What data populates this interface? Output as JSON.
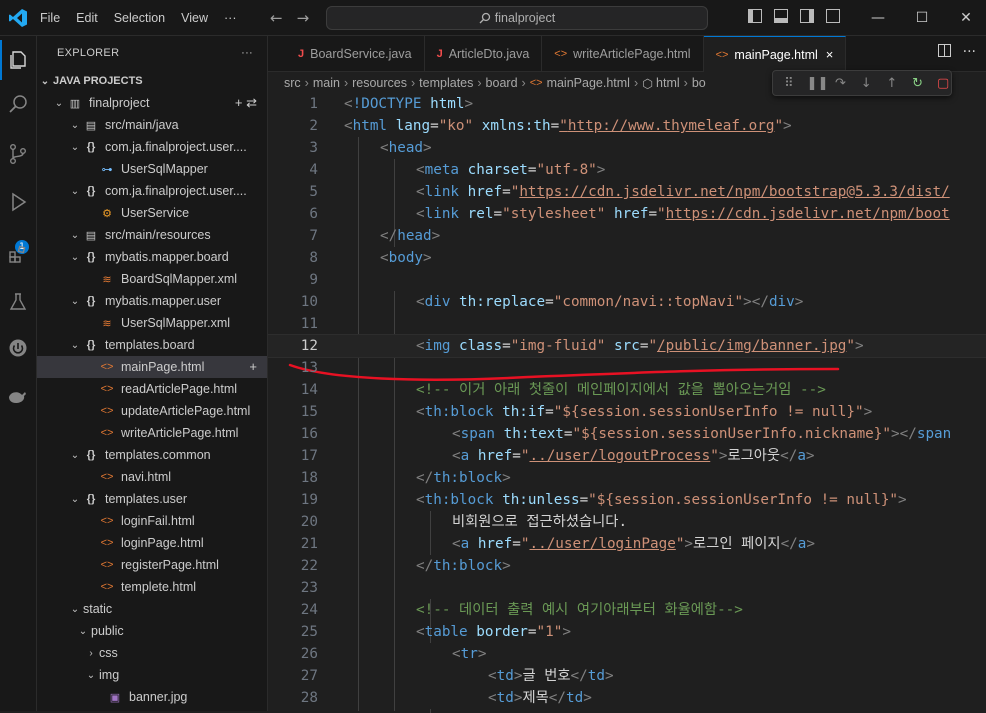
{
  "menu": {
    "items": [
      "File",
      "Edit",
      "Selection",
      "View",
      "···"
    ]
  },
  "search": {
    "text": "finalproject"
  },
  "explorer": {
    "header": "EXPLORER",
    "more": "···",
    "section": "JAVA PROJECTS",
    "tree": [
      {
        "label": "finalproject",
        "chev": "⌄",
        "icon": "▥",
        "iconClass": "folder",
        "depth": 0
      },
      {
        "label": "src/main/java",
        "chev": "⌄",
        "icon": "▤",
        "iconClass": "folder",
        "depth": 1
      },
      {
        "label": "com.ja.finalproject.user....",
        "chev": "⌄",
        "icon": "{}",
        "iconClass": "pkg",
        "depth": 1
      },
      {
        "label": "UserSqlMapper",
        "chev": "",
        "icon": "⊶",
        "iconClass": "iface",
        "depth": 2
      },
      {
        "label": "com.ja.finalproject.user....",
        "chev": "⌄",
        "icon": "{}",
        "iconClass": "pkg",
        "depth": 1
      },
      {
        "label": "UserService",
        "chev": "",
        "icon": "⚙",
        "iconClass": "cls",
        "depth": 2
      },
      {
        "label": "src/main/resources",
        "chev": "⌄",
        "icon": "▤",
        "iconClass": "folder",
        "depth": 1
      },
      {
        "label": "mybatis.mapper.board",
        "chev": "⌄",
        "icon": "{}",
        "iconClass": "pkg",
        "depth": 1
      },
      {
        "label": "BoardSqlMapper.xml",
        "chev": "",
        "icon": "≋",
        "iconClass": "xml",
        "depth": 2
      },
      {
        "label": "mybatis.mapper.user",
        "chev": "⌄",
        "icon": "{}",
        "iconClass": "pkg",
        "depth": 1
      },
      {
        "label": "UserSqlMapper.xml",
        "chev": "",
        "icon": "≋",
        "iconClass": "xml",
        "depth": 2
      },
      {
        "label": "templates.board",
        "chev": "⌄",
        "icon": "{}",
        "iconClass": "pkg",
        "depth": 1
      },
      {
        "label": "mainPage.html",
        "chev": "",
        "icon": "<>",
        "iconClass": "html",
        "depth": 2,
        "selected": true
      },
      {
        "label": "readArticlePage.html",
        "chev": "",
        "icon": "<>",
        "iconClass": "html",
        "depth": 2
      },
      {
        "label": "updateArticlePage.html",
        "chev": "",
        "icon": "<>",
        "iconClass": "html",
        "depth": 2
      },
      {
        "label": "writeArticlePage.html",
        "chev": "",
        "icon": "<>",
        "iconClass": "html",
        "depth": 2
      },
      {
        "label": "templates.common",
        "chev": "⌄",
        "icon": "{}",
        "iconClass": "pkg",
        "depth": 1
      },
      {
        "label": "navi.html",
        "chev": "",
        "icon": "<>",
        "iconClass": "html",
        "depth": 2
      },
      {
        "label": "templates.user",
        "chev": "⌄",
        "icon": "{}",
        "iconClass": "pkg",
        "depth": 1
      },
      {
        "label": "loginFail.html",
        "chev": "",
        "icon": "<>",
        "iconClass": "html",
        "depth": 2
      },
      {
        "label": "loginPage.html",
        "chev": "",
        "icon": "<>",
        "iconClass": "html",
        "depth": 2
      },
      {
        "label": "registerPage.html",
        "chev": "",
        "icon": "<>",
        "iconClass": "html",
        "depth": 2
      },
      {
        "label": "templete.html",
        "chev": "",
        "icon": "<>",
        "iconClass": "html",
        "depth": 2
      },
      {
        "label": "static",
        "chev": "⌄",
        "icon": "",
        "iconClass": "folder",
        "depth": 1
      },
      {
        "label": "public",
        "chev": "⌄",
        "icon": "",
        "iconClass": "folder",
        "depth": 1.5
      },
      {
        "label": "css",
        "chev": "›",
        "icon": "",
        "iconClass": "folder",
        "depth": 2
      },
      {
        "label": "img",
        "chev": "⌄",
        "icon": "",
        "iconClass": "folder",
        "depth": 2
      },
      {
        "label": "banner.jpg",
        "chev": "",
        "icon": "▣",
        "iconClass": "img",
        "depth": 2.5
      }
    ]
  },
  "tabs": [
    {
      "label": "BoardService.java",
      "icon": "J",
      "iconColor": "#f14c4c"
    },
    {
      "label": "ArticleDto.java",
      "icon": "J",
      "iconColor": "#f14c4c"
    },
    {
      "label": "writeArticlePage.html",
      "icon": "<>",
      "iconColor": "#e37933"
    },
    {
      "label": "mainPage.html",
      "icon": "<>",
      "iconColor": "#e37933",
      "active": true,
      "close": "×"
    }
  ],
  "breadcrumb": [
    "src",
    "main",
    "resources",
    "templates",
    "board",
    "mainPage.html",
    "html",
    "bo"
  ],
  "badge": "1",
  "code": {
    "currentLine": 12,
    "lines": [
      {
        "n": 1,
        "ind": 0,
        "toks": [
          [
            "punc",
            "<"
          ],
          [
            "tag",
            "!DOCTYPE"
          ],
          [
            "txt",
            " "
          ],
          [
            "attr",
            "html"
          ],
          [
            "punc",
            ">"
          ]
        ]
      },
      {
        "n": 2,
        "ind": 0,
        "toks": [
          [
            "punc",
            "<"
          ],
          [
            "tag",
            "html"
          ],
          [
            "txt",
            " "
          ],
          [
            "attr",
            "lang"
          ],
          [
            "txt",
            "="
          ],
          [
            "str",
            "\"ko\""
          ],
          [
            "txt",
            " "
          ],
          [
            "attr",
            "xmlns:th"
          ],
          [
            "txt",
            "="
          ],
          [
            "str",
            "\"",
            "u"
          ],
          [
            "str",
            "http://www.thymeleaf.org",
            "u"
          ],
          [
            "str",
            "\""
          ],
          [
            "punc",
            ">"
          ]
        ]
      },
      {
        "n": 3,
        "ind": 1,
        "toks": [
          [
            "punc",
            "<"
          ],
          [
            "tag",
            "head"
          ],
          [
            "punc",
            ">"
          ]
        ]
      },
      {
        "n": 4,
        "ind": 2,
        "toks": [
          [
            "punc",
            "<"
          ],
          [
            "tag",
            "meta"
          ],
          [
            "txt",
            " "
          ],
          [
            "attr",
            "charset"
          ],
          [
            "txt",
            "="
          ],
          [
            "str",
            "\"utf-8\""
          ],
          [
            "punc",
            ">"
          ]
        ]
      },
      {
        "n": 5,
        "ind": 2,
        "toks": [
          [
            "punc",
            "<"
          ],
          [
            "tag",
            "link"
          ],
          [
            "txt",
            " "
          ],
          [
            "attr",
            "href"
          ],
          [
            "txt",
            "="
          ],
          [
            "str",
            "\""
          ],
          [
            "str",
            "https://cdn.jsdelivr.net/npm/bootstrap@5.3.3/dist/",
            "u"
          ]
        ]
      },
      {
        "n": 6,
        "ind": 2,
        "toks": [
          [
            "punc",
            "<"
          ],
          [
            "tag",
            "link"
          ],
          [
            "txt",
            " "
          ],
          [
            "attr",
            "rel"
          ],
          [
            "txt",
            "="
          ],
          [
            "str",
            "\"stylesheet\""
          ],
          [
            "txt",
            " "
          ],
          [
            "attr",
            "href"
          ],
          [
            "txt",
            "="
          ],
          [
            "str",
            "\""
          ],
          [
            "str",
            "https://cdn.jsdelivr.net/npm/boot",
            "u"
          ]
        ]
      },
      {
        "n": 7,
        "ind": 1,
        "toks": [
          [
            "punc",
            "</"
          ],
          [
            "tag",
            "head"
          ],
          [
            "punc",
            ">"
          ]
        ]
      },
      {
        "n": 8,
        "ind": 1,
        "toks": [
          [
            "punc",
            "<"
          ],
          [
            "tag",
            "body"
          ],
          [
            "punc",
            ">"
          ]
        ]
      },
      {
        "n": 9,
        "ind": 0,
        "toks": []
      },
      {
        "n": 10,
        "ind": 2,
        "toks": [
          [
            "punc",
            "<"
          ],
          [
            "tag",
            "div"
          ],
          [
            "txt",
            " "
          ],
          [
            "attr",
            "th:replace"
          ],
          [
            "txt",
            "="
          ],
          [
            "str",
            "\"common/navi::topNavi\""
          ],
          [
            "punc",
            ">"
          ],
          [
            "punc",
            "</"
          ],
          [
            "tag",
            "div"
          ],
          [
            "punc",
            ">"
          ]
        ]
      },
      {
        "n": 11,
        "ind": 0,
        "toks": []
      },
      {
        "n": 12,
        "ind": 2,
        "toks": [
          [
            "punc",
            "<"
          ],
          [
            "tag",
            "img"
          ],
          [
            "txt",
            " "
          ],
          [
            "attr",
            "class"
          ],
          [
            "txt",
            "="
          ],
          [
            "str",
            "\"img-fluid\""
          ],
          [
            "txt",
            " "
          ],
          [
            "attr",
            "src"
          ],
          [
            "txt",
            "="
          ],
          [
            "str",
            "\""
          ],
          [
            "str",
            "/public/img/banner.jpg",
            "u"
          ],
          [
            "str",
            "\""
          ],
          [
            "punc",
            ">"
          ]
        ]
      },
      {
        "n": 13,
        "ind": 0,
        "toks": []
      },
      {
        "n": 14,
        "ind": 2,
        "toks": [
          [
            "com",
            "<!-- 이거 아래 첫줄이 메인페이지에서 값을 뽑아오는거임 -->"
          ]
        ]
      },
      {
        "n": 15,
        "ind": 2,
        "toks": [
          [
            "punc",
            "<"
          ],
          [
            "tag",
            "th:block"
          ],
          [
            "txt",
            " "
          ],
          [
            "attr",
            "th:if"
          ],
          [
            "txt",
            "="
          ],
          [
            "str",
            "\"${session.sessionUserInfo != null}\""
          ],
          [
            "punc",
            ">"
          ]
        ]
      },
      {
        "n": 16,
        "ind": 3,
        "toks": [
          [
            "punc",
            "<"
          ],
          [
            "tag",
            "span"
          ],
          [
            "txt",
            " "
          ],
          [
            "attr",
            "th:text"
          ],
          [
            "txt",
            "="
          ],
          [
            "str",
            "\"${session.sessionUserInfo.nickname}\""
          ],
          [
            "punc",
            ">"
          ],
          [
            "punc",
            "</"
          ],
          [
            "tag",
            "span"
          ]
        ]
      },
      {
        "n": 17,
        "ind": 3,
        "toks": [
          [
            "punc",
            "<"
          ],
          [
            "tag",
            "a"
          ],
          [
            "txt",
            " "
          ],
          [
            "attr",
            "href"
          ],
          [
            "txt",
            "="
          ],
          [
            "str",
            "\""
          ],
          [
            "str",
            "../user/logoutProcess",
            "u"
          ],
          [
            "str",
            "\""
          ],
          [
            "punc",
            ">"
          ],
          [
            "txt",
            "로그아웃"
          ],
          [
            "punc",
            "</"
          ],
          [
            "tag",
            "a"
          ],
          [
            "punc",
            ">"
          ]
        ]
      },
      {
        "n": 18,
        "ind": 2,
        "toks": [
          [
            "punc",
            "</"
          ],
          [
            "tag",
            "th:block"
          ],
          [
            "punc",
            ">"
          ]
        ]
      },
      {
        "n": 19,
        "ind": 2,
        "toks": [
          [
            "punc",
            "<"
          ],
          [
            "tag",
            "th:block"
          ],
          [
            "txt",
            " "
          ],
          [
            "attr",
            "th:unless"
          ],
          [
            "txt",
            "="
          ],
          [
            "str",
            "\"${session.sessionUserInfo != null}\""
          ],
          [
            "punc",
            ">"
          ]
        ]
      },
      {
        "n": 20,
        "ind": 3,
        "toks": [
          [
            "txt",
            "비회원으로 접근하셨습니다."
          ]
        ]
      },
      {
        "n": 21,
        "ind": 3,
        "toks": [
          [
            "punc",
            "<"
          ],
          [
            "tag",
            "a"
          ],
          [
            "txt",
            " "
          ],
          [
            "attr",
            "href"
          ],
          [
            "txt",
            "="
          ],
          [
            "str",
            "\""
          ],
          [
            "str",
            "../user/loginPage",
            "u"
          ],
          [
            "str",
            "\""
          ],
          [
            "punc",
            ">"
          ],
          [
            "txt",
            "로그인 페이지"
          ],
          [
            "punc",
            "</"
          ],
          [
            "tag",
            "a"
          ],
          [
            "punc",
            ">"
          ]
        ]
      },
      {
        "n": 22,
        "ind": 2,
        "toks": [
          [
            "punc",
            "</"
          ],
          [
            "tag",
            "th:block"
          ],
          [
            "punc",
            ">"
          ]
        ]
      },
      {
        "n": 23,
        "ind": 0,
        "toks": []
      },
      {
        "n": 24,
        "ind": 2,
        "toks": [
          [
            "com",
            "<!-- 데이터 출력 예시 여기아래부터 화율에함-->"
          ]
        ]
      },
      {
        "n": 25,
        "ind": 2,
        "toks": [
          [
            "punc",
            "<"
          ],
          [
            "tag",
            "table"
          ],
          [
            "txt",
            " "
          ],
          [
            "attr",
            "border"
          ],
          [
            "txt",
            "="
          ],
          [
            "str",
            "\"1\""
          ],
          [
            "punc",
            ">"
          ]
        ]
      },
      {
        "n": 26,
        "ind": 3,
        "toks": [
          [
            "punc",
            "<"
          ],
          [
            "tag",
            "tr"
          ],
          [
            "punc",
            ">"
          ]
        ]
      },
      {
        "n": 27,
        "ind": 4,
        "toks": [
          [
            "punc",
            "<"
          ],
          [
            "tag",
            "td"
          ],
          [
            "punc",
            ">"
          ],
          [
            "txt",
            "글 번호"
          ],
          [
            "punc",
            "</"
          ],
          [
            "tag",
            "td"
          ],
          [
            "punc",
            ">"
          ]
        ]
      },
      {
        "n": 28,
        "ind": 4,
        "toks": [
          [
            "punc",
            "<"
          ],
          [
            "tag",
            "td"
          ],
          [
            "punc",
            ">"
          ],
          [
            "txt",
            "제목"
          ],
          [
            "punc",
            "</"
          ],
          [
            "tag",
            "td"
          ],
          [
            "punc",
            ">"
          ]
        ]
      }
    ]
  }
}
